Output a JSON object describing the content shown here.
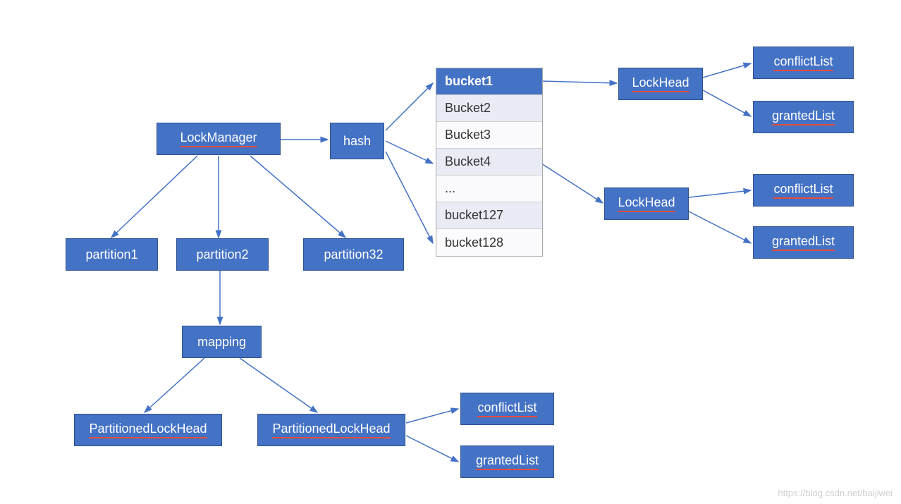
{
  "nodes": {
    "lockManager": "LockManager",
    "hash": "hash",
    "partition1": "partition1",
    "partition2": "partition2",
    "partition32": "partition32",
    "mapping": "mapping",
    "partitionedLockHead1": "PartitionedLockHead",
    "partitionedLockHead2": "PartitionedLockHead",
    "conflictListMid": "conflictList",
    "grantedListMid": "grantedList",
    "lockHead1": "LockHead",
    "conflictList1": "conflictList",
    "grantedList1": "grantedList",
    "lockHead2": "LockHead",
    "conflictList2": "conflictList",
    "grantedList2": "grantedList"
  },
  "buckets": {
    "rows": [
      {
        "label": "bucket1",
        "type": "header"
      },
      {
        "label": "Bucket2",
        "type": "alt"
      },
      {
        "label": "Bucket3",
        "type": "plain"
      },
      {
        "label": "Bucket4",
        "type": "alt"
      },
      {
        "label": "...",
        "type": "plain"
      },
      {
        "label": "bucket127",
        "type": "alt"
      },
      {
        "label": "bucket128",
        "type": "plain"
      }
    ]
  },
  "colors": {
    "boxFill": "#4472c4",
    "boxBorder": "#2f528f",
    "arrow": "#4472c4",
    "underline": "#e74c3c"
  },
  "watermark": "https://blog.csdn.net/baijiwei"
}
